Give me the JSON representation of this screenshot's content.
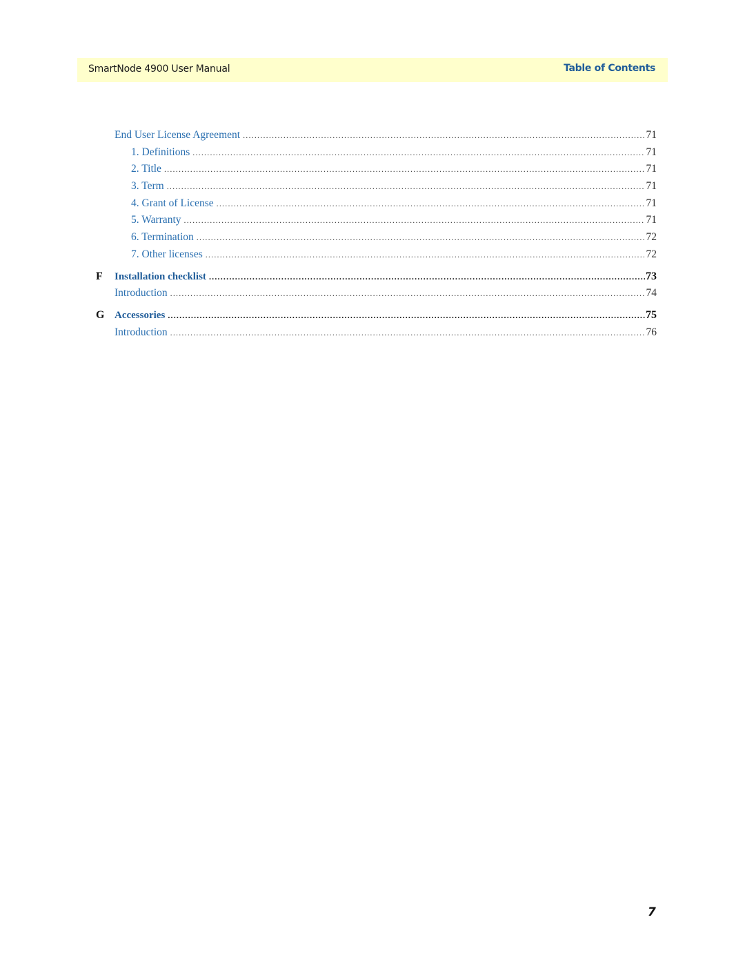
{
  "header": {
    "title": "SmartNode 4900 User Manual",
    "section": "Table of Contents",
    "background_color": "#ffffcc",
    "accent_color": "#1f5c99"
  },
  "toc": [
    {
      "letter": "",
      "label": "End User License Agreement",
      "page": "71",
      "level": 1,
      "bold": false
    },
    {
      "letter": "",
      "label": "1. Definitions",
      "page": "71",
      "level": 2,
      "bold": false
    },
    {
      "letter": "",
      "label": "2. Title",
      "page": "71",
      "level": 2,
      "bold": false
    },
    {
      "letter": "",
      "label": "3. Term",
      "page": "71",
      "level": 2,
      "bold": false
    },
    {
      "letter": "",
      "label": "4. Grant of License",
      "page": "71",
      "level": 2,
      "bold": false
    },
    {
      "letter": "",
      "label": "5. Warranty",
      "page": "71",
      "level": 2,
      "bold": false
    },
    {
      "letter": "",
      "label": "6. Termination",
      "page": "72",
      "level": 2,
      "bold": false
    },
    {
      "letter": "",
      "label": "7. Other licenses",
      "page": "72",
      "level": 2,
      "bold": false
    },
    {
      "letter": "F",
      "label": "Installation checklist",
      "page": "73",
      "level": 1,
      "bold": true
    },
    {
      "letter": "",
      "label": "Introduction",
      "page": "74",
      "level": 1,
      "bold": false
    },
    {
      "letter": "G",
      "label": "Accessories",
      "page": "75",
      "level": 1,
      "bold": true
    },
    {
      "letter": "",
      "label": "Introduction",
      "page": "76",
      "level": 1,
      "bold": false
    }
  ],
  "footer": {
    "page_number": "7"
  }
}
